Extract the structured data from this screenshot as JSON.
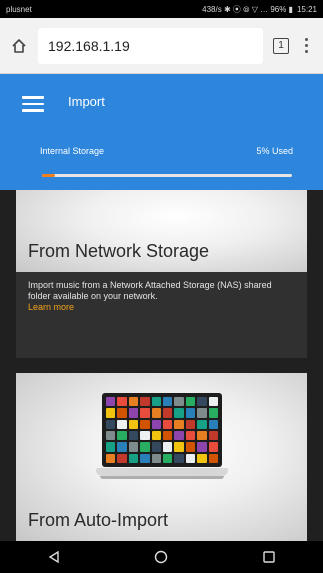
{
  "status_bar": {
    "carrier": "plusnet",
    "indicators": "438/s ✱ ⦿ ⦾ ▽ … 96% ▮",
    "time": "15:21"
  },
  "browser": {
    "url": "192.168.1.19",
    "tab_count": "1",
    "home_icon": "home-icon",
    "menu_icon": "more-vert-icon"
  },
  "app": {
    "title": "Import",
    "storage_label": "Internal Storage",
    "storage_used": "5% Used",
    "storage_fraction": 0.05,
    "accent_color": "#2d86dc",
    "bar_color": "#ef7f1a"
  },
  "cards": [
    {
      "title": "From Network Storage",
      "description": "Import music from a Network Attached Storage (NAS) shared folder available on your network.",
      "link": "Learn more"
    },
    {
      "title": "From Auto-Import"
    }
  ],
  "nav": {
    "back_icon": "back-triangle-icon",
    "home_icon": "home-circle-icon",
    "recents_icon": "recents-square-icon"
  }
}
